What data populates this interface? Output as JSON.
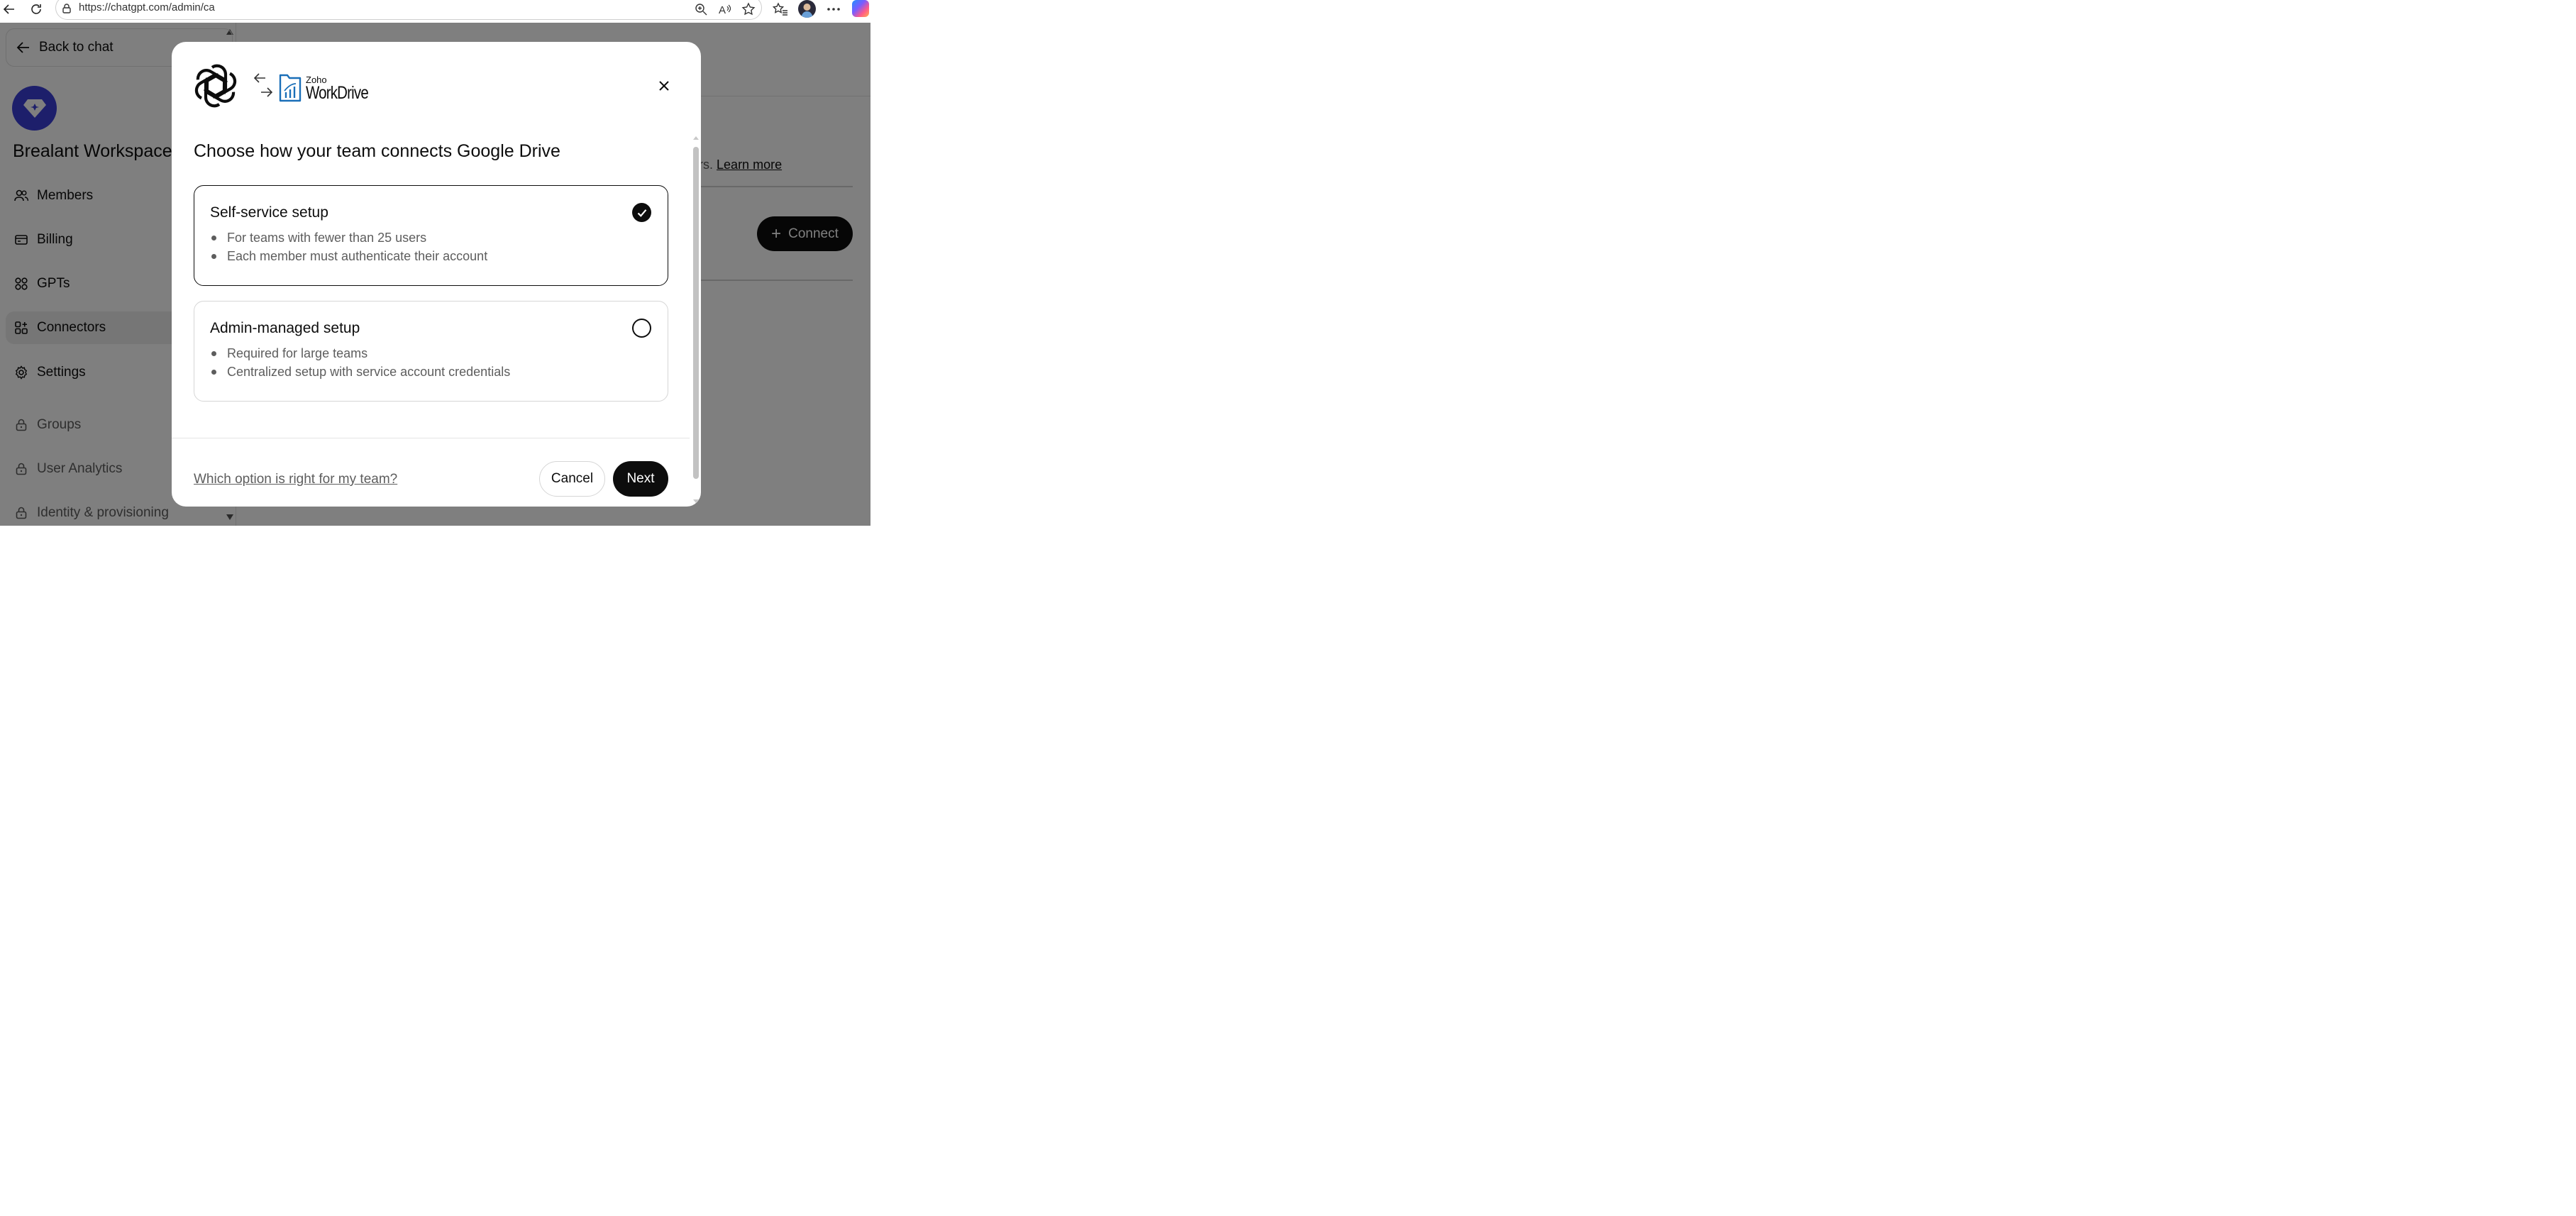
{
  "browser": {
    "url": "https://chatgpt.com/admin/ca",
    "icons": [
      "back-arrow-icon",
      "refresh-icon",
      "lock-icon",
      "zoom-icon",
      "read-aloud-icon",
      "favorite-star-icon",
      "favorites-icon",
      "profile-avatar",
      "more-icon",
      "copilot-icon"
    ]
  },
  "sidebar": {
    "back_label": "Back to chat",
    "workspace_name": "Brealant Workspace",
    "items": [
      {
        "label": "Members",
        "icon": "members-icon"
      },
      {
        "label": "Billing",
        "icon": "billing-icon"
      },
      {
        "label": "GPTs",
        "icon": "gpts-grid-icon"
      },
      {
        "label": "Connectors",
        "icon": "connectors-icon",
        "active": true
      },
      {
        "label": "Settings",
        "icon": "gear-icon"
      },
      {
        "label": "Groups",
        "icon": "lock-icon",
        "locked": true
      },
      {
        "label": "User Analytics",
        "icon": "lock-icon",
        "locked": true
      },
      {
        "label": "Identity & provisioning",
        "icon": "lock-icon",
        "locked": true
      }
    ]
  },
  "main": {
    "description_fragment": "ers.",
    "learn_more": "Learn more",
    "connect_label": "Connect",
    "connect_plus": "+"
  },
  "modal": {
    "logo_small": "Zoho",
    "logo_big": "WorkDrive",
    "title": "Choose how your team connects Google Drive",
    "options": [
      {
        "title": "Self-service setup",
        "bullets": [
          "For teams with fewer than 25 users",
          "Each member must authenticate their account"
        ],
        "selected": true
      },
      {
        "title": "Admin-managed setup",
        "bullets": [
          "Required for large teams",
          "Centralized setup with service account credentials"
        ],
        "selected": false
      }
    ],
    "help_link": "Which option is right for my team?",
    "cancel_label": "Cancel",
    "next_label": "Next"
  },
  "colors": {
    "primary_dark": "#0d0d0d",
    "workspace_accent": "#3b3fd6",
    "zoho_blue": "#1a6fb8",
    "overlay": "rgba(0,0,0,0.5)"
  }
}
